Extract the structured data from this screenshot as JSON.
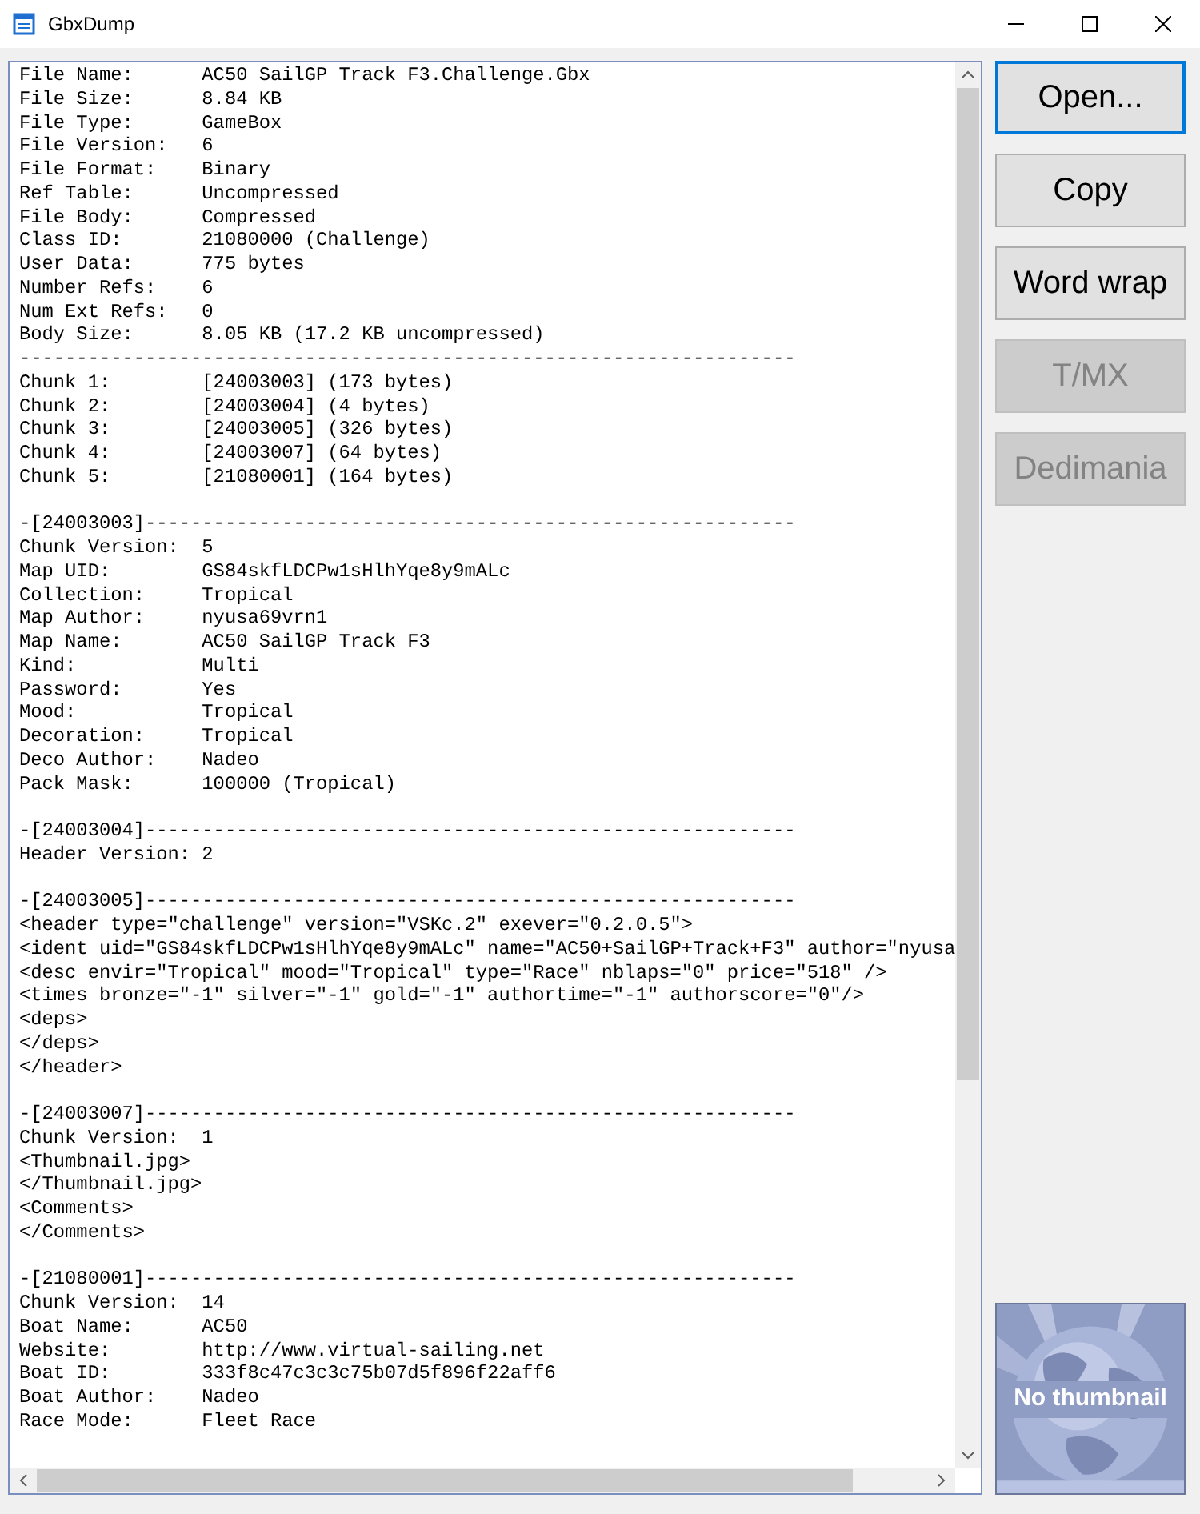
{
  "window": {
    "title": "GbxDump"
  },
  "text_view": {
    "summary": {
      "lines": [
        "File Name:      AC50 SailGP Track F3.Challenge.Gbx",
        "File Size:      8.84 KB",
        "File Type:      GameBox",
        "File Version:   6",
        "File Format:    Binary",
        "Ref Table:      Uncompressed",
        "File Body:      Compressed",
        "Class ID:       21080000 (Challenge)",
        "User Data:      775 bytes",
        "Number Refs:    6",
        "Num Ext Refs:   0",
        "Body Size:      8.05 KB (17.2 KB uncompressed)"
      ],
      "rule": "--------------------------------------------------------------------",
      "chunks": [
        "Chunk 1:        [24003003] (173 bytes)",
        "Chunk 2:        [24003004] (4 bytes)",
        "Chunk 3:        [24003005] (326 bytes)",
        "Chunk 4:        [24003007] (64 bytes)",
        "Chunk 5:        [21080001] (164 bytes)"
      ]
    },
    "sections": [
      {
        "heading": "-[24003003]---------------------------------------------------------",
        "lines": [
          "Chunk Version:  5",
          "Map UID:        GS84skfLDCPw1sHlhYqe8y9mALc",
          "Collection:     Tropical",
          "Map Author:     nyusa69vrn1",
          "Map Name:       AC50 SailGP Track F3",
          "Kind:           Multi",
          "Password:       Yes",
          "Mood:           Tropical",
          "Decoration:     Tropical",
          "Deco Author:    Nadeo",
          "Pack Mask:      100000 (Tropical)"
        ]
      },
      {
        "heading": "-[24003004]---------------------------------------------------------",
        "lines": [
          "Header Version: 2"
        ]
      },
      {
        "heading": "-[24003005]---------------------------------------------------------",
        "lines": [
          "<header type=\"challenge\" version=\"VSKc.2\" exever=\"0.2.0.5\">",
          "<ident uid=\"GS84skfLDCPw1sHlhYqe8y9mALc\" name=\"AC50+SailGP+Track+F3\" author=\"nyusa",
          "<desc envir=\"Tropical\" mood=\"Tropical\" type=\"Race\" nblaps=\"0\" price=\"518\" />",
          "<times bronze=\"-1\" silver=\"-1\" gold=\"-1\" authortime=\"-1\" authorscore=\"0\"/>",
          "<deps>",
          "</deps>",
          "</header>"
        ]
      },
      {
        "heading": "-[24003007]---------------------------------------------------------",
        "lines": [
          "Chunk Version:  1",
          "<Thumbnail.jpg>",
          "</Thumbnail.jpg>",
          "<Comments>",
          "</Comments>"
        ]
      },
      {
        "heading": "-[21080001]---------------------------------------------------------",
        "lines": [
          "Chunk Version:  14",
          "Boat Name:      AC50",
          "Website:        http://www.virtual-sailing.net",
          "Boat ID:        333f8c47c3c3c75b07d5f896f22aff6",
          "Boat Author:    Nadeo",
          "Race Mode:      Fleet Race"
        ]
      }
    ]
  },
  "buttons": [
    {
      "label": "Open...",
      "default": true,
      "disabled": false
    },
    {
      "label": "Copy",
      "default": false,
      "disabled": false
    },
    {
      "label": "Word wrap",
      "default": false,
      "disabled": false
    },
    {
      "label": "T/MX",
      "default": false,
      "disabled": true
    },
    {
      "label": "Dedimania",
      "default": false,
      "disabled": true
    }
  ],
  "thumbnail": {
    "label": "No thumbnail"
  }
}
